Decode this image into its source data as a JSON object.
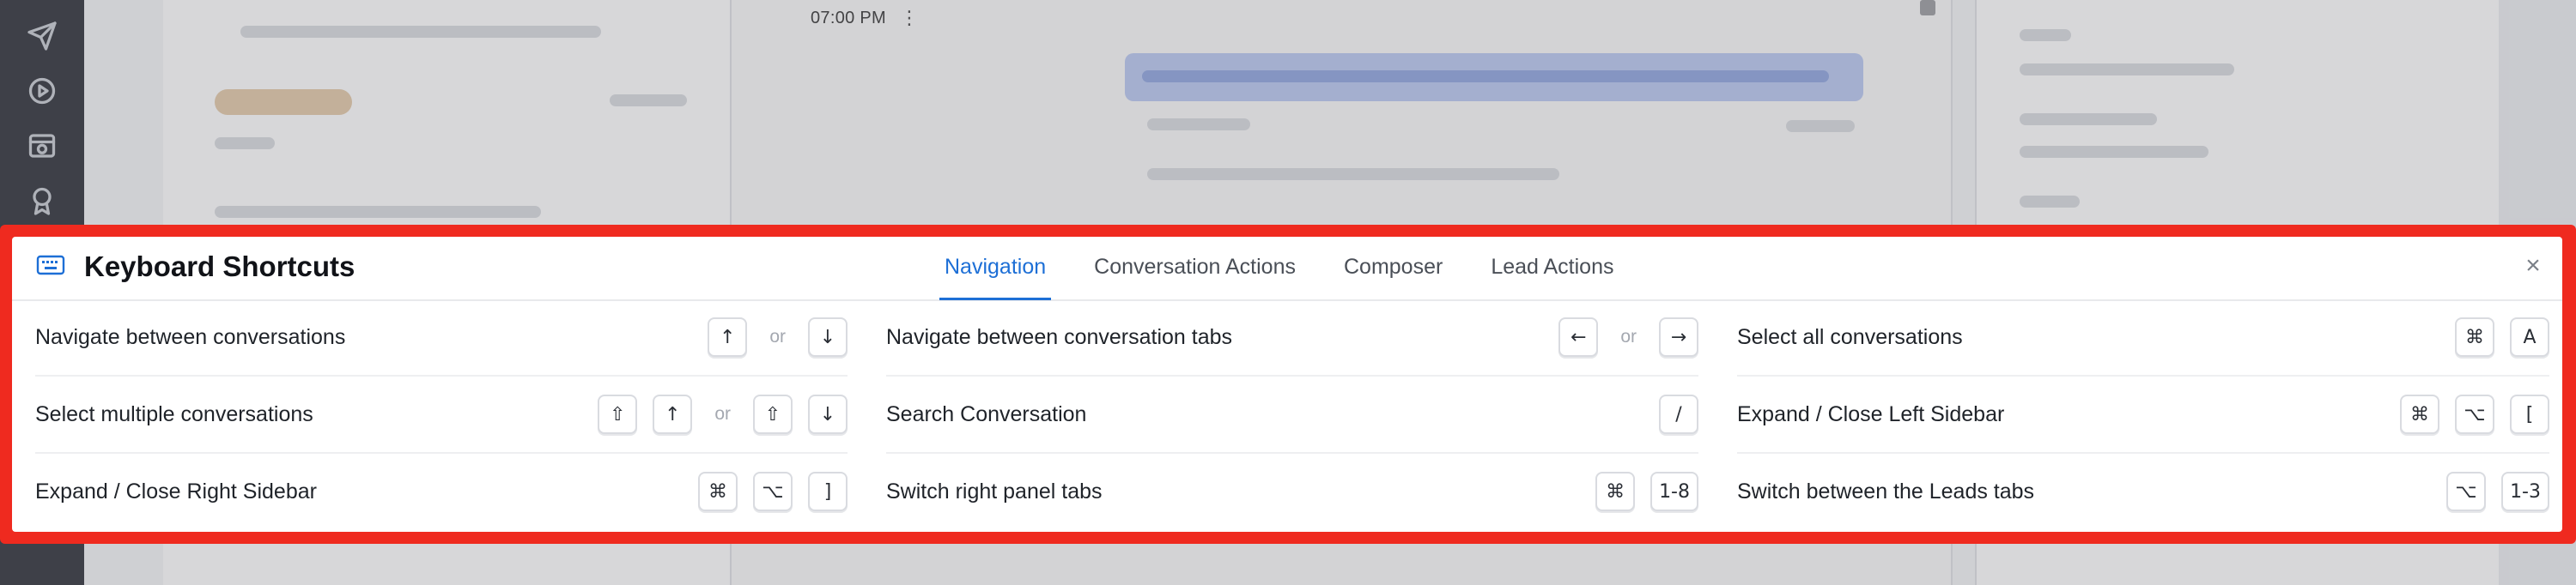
{
  "background": {
    "chat_time": "07:00 PM"
  },
  "shortcuts_panel": {
    "title": "Keyboard Shortcuts",
    "tabs": [
      {
        "label": "Navigation",
        "active": true
      },
      {
        "label": "Conversation Actions",
        "active": false
      },
      {
        "label": "Composer",
        "active": false
      },
      {
        "label": "Lead Actions",
        "active": false
      }
    ],
    "close_label": "×",
    "or_label": "or",
    "columns": [
      {
        "rows": [
          {
            "label": "Navigate between conversations",
            "keys": [
              "↑",
              "or",
              "↓"
            ]
          },
          {
            "label": "Select multiple conversations",
            "keys": [
              "⇧",
              "↑",
              "or",
              "⇧",
              "↓"
            ]
          },
          {
            "label": "Expand / Close Right Sidebar",
            "keys": [
              "⌘",
              "⌥",
              "]"
            ]
          }
        ]
      },
      {
        "rows": [
          {
            "label": "Navigate between conversation tabs",
            "keys": [
              "←",
              "or",
              "→"
            ]
          },
          {
            "label": "Search Conversation",
            "keys": [
              "/"
            ]
          },
          {
            "label": "Switch right panel tabs",
            "keys": [
              "⌘",
              "1-8"
            ]
          }
        ]
      },
      {
        "rows": [
          {
            "label": "Select all conversations",
            "keys": [
              "⌘",
              "A"
            ]
          },
          {
            "label": "Expand / Close Left Sidebar",
            "keys": [
              "⌘",
              "⌥",
              "["
            ]
          },
          {
            "label": "Switch between the Leads tabs",
            "keys": [
              "⌥",
              "1-3"
            ]
          }
        ]
      }
    ]
  },
  "colors": {
    "accent": "#1d6fd6",
    "highlight_frame": "#ef2a1f",
    "rail": "#2b2f36"
  }
}
